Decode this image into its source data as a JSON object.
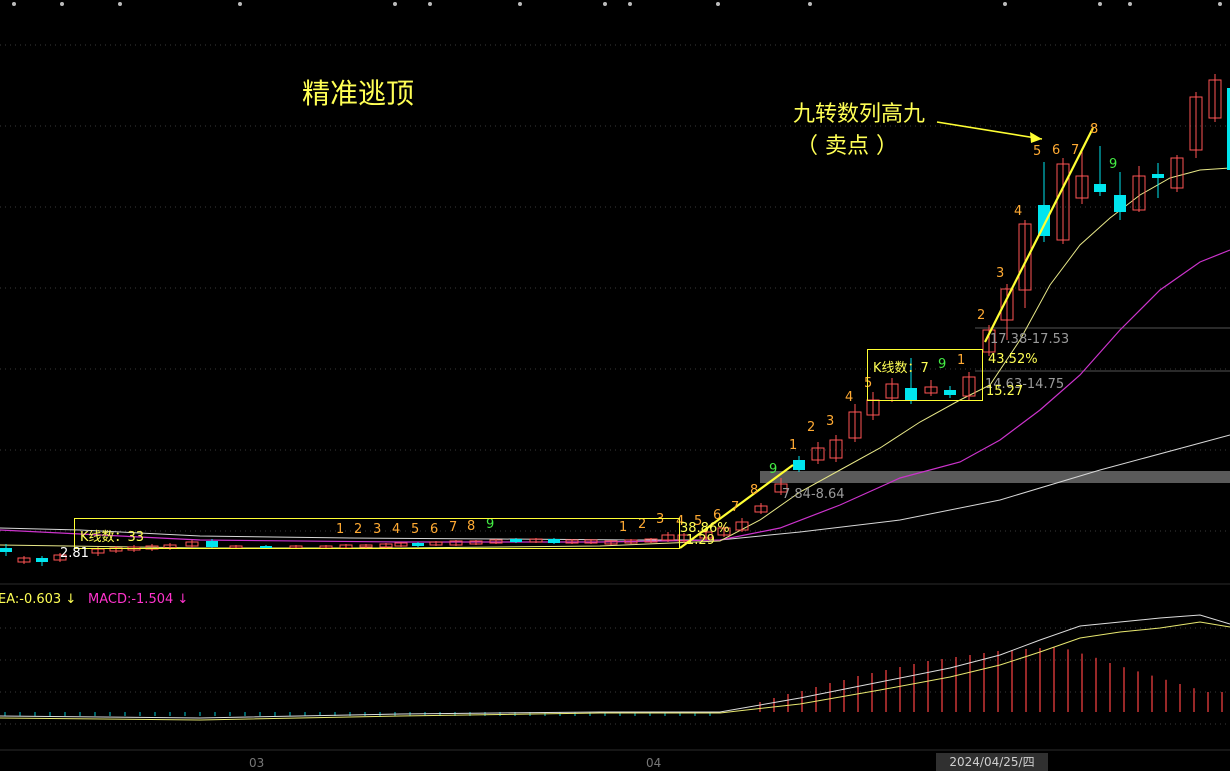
{
  "headline": "精准逃顶",
  "annotation": {
    "line1": "九转数列高九",
    "line2": "（ 卖点 ）"
  },
  "kline_box_1": {
    "label": "K线数：33"
  },
  "kline_box_2": {
    "label": "K线数：7"
  },
  "count_seq_1": [
    "1",
    "2",
    "3",
    "4",
    "5",
    "6",
    "7",
    "8",
    "9"
  ],
  "count_seq_2": [
    "1",
    "2",
    "3",
    "4",
    "5",
    "6",
    "7",
    "8",
    "9"
  ],
  "count_seq_3": [
    "1",
    "2",
    "3",
    "4",
    "5"
  ],
  "count_seq_4": [
    "1",
    "2",
    "3",
    "4",
    "5",
    "6",
    "7",
    "8"
  ],
  "price_labels": {
    "low_price": "2.81",
    "band_1": "7.84-8.64",
    "band_2": "14.63-14.75",
    "band_3": "17.38-17.53",
    "pct_1": "38.86%",
    "pct_2": "43.52%",
    "val_1": "1.29",
    "val_2": "15.27"
  },
  "macd": {
    "ea": "EA:-0.603",
    "ea_arrow": "↓",
    "macd": "MACD:-1.504",
    "macd_arrow": "↓"
  },
  "x_axis": {
    "tick_1": "03",
    "tick_2": "04",
    "crosshair_date": "2024/04/25/四"
  },
  "colors": {
    "up": "#ff5555",
    "down": "#00e5ee",
    "text": "#ffff55",
    "ma_magenta": "#cc33cc",
    "ma_white": "#d8d8d8"
  }
}
